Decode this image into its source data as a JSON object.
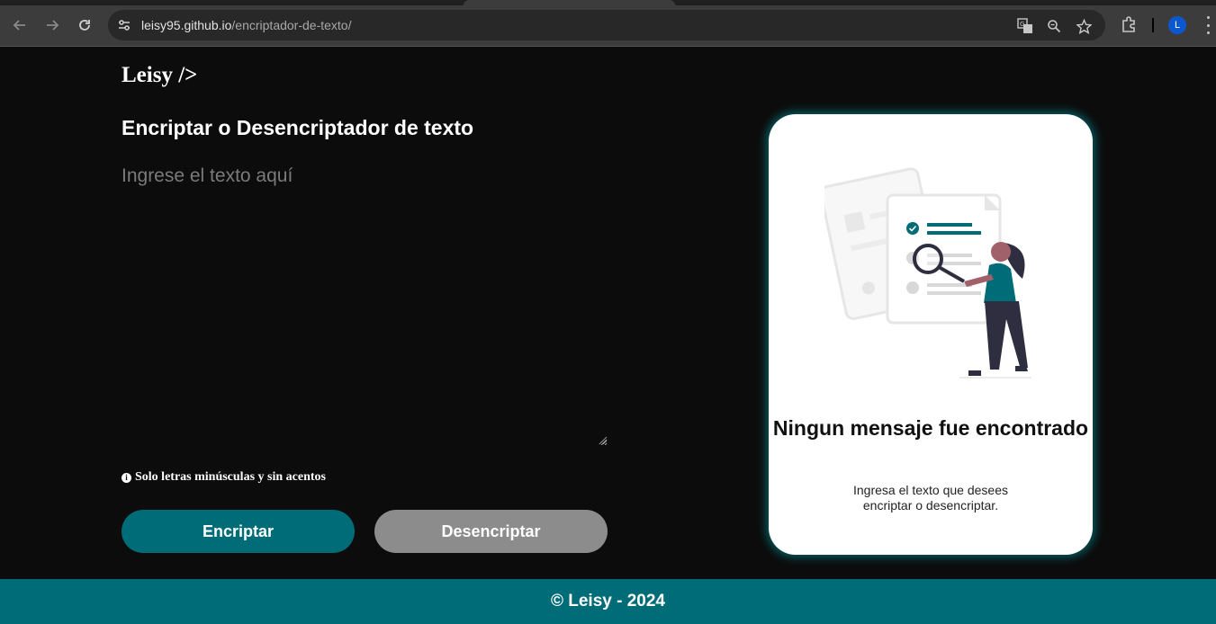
{
  "browser": {
    "url_host": "leisy95.github.io",
    "url_path": "/encriptador-de-texto/",
    "profile_initial": "L",
    "icons": [
      "back-arrow-icon",
      "forward-arrow-icon",
      "reload-icon",
      "site-settings-icon",
      "translate-icon",
      "zoom-icon",
      "bookmark-star-icon",
      "extensions-icon",
      "more-menu-icon"
    ]
  },
  "page": {
    "logo": "Leisy />",
    "title": "Encriptar o Desencriptador de texto",
    "input_placeholder": "Ingrese el texto aquí",
    "hint_icon": "i",
    "hint": "Solo letras minúsculas y sin acentos",
    "encrypt_label": "Encriptar",
    "decrypt_label": "Desencriptar"
  },
  "result_card": {
    "title": "Ningun mensaje fue encontrado",
    "text": "Ingresa el texto que desees encriptar o desencriptar."
  },
  "footer": {
    "text": "© Leisy - 2024"
  },
  "colors": {
    "background": "#0c0c0c",
    "accent": "#006c77",
    "secondary_button": "#8c8c8c",
    "card": "#ffffff"
  }
}
